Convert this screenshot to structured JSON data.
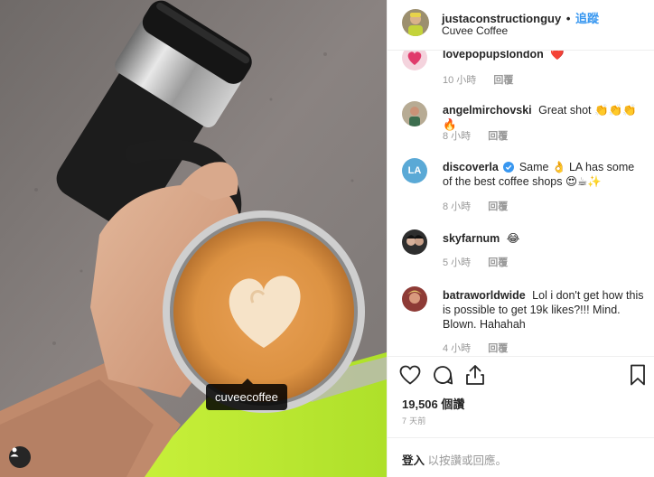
{
  "post": {
    "photo_tag": "cuveecoffee",
    "author": {
      "username": "justaconstructionguy",
      "dot": "•",
      "follow_label": "追蹤",
      "location": "Cuvee Coffee"
    },
    "comments": [
      {
        "username": "lovepopupslondon",
        "text": "❤️",
        "time": "10 小時",
        "reply": "回覆",
        "avatar_color": "#e03a6b"
      },
      {
        "username": "angelmirchovski",
        "text": "Great shot 👏👏👏🔥",
        "time": "8 小時",
        "reply": "回覆",
        "avatar_color": "#9a8f7a"
      },
      {
        "username": "discoverla",
        "verified": true,
        "text": "Same 👌 LA has some of the best coffee shops 😍☕✨",
        "time": "8 小時",
        "reply": "回覆",
        "avatar_label": "LA",
        "avatar_color": "#5aa9d6"
      },
      {
        "username": "skyfarnum",
        "text": "😂",
        "time": "5 小時",
        "reply": "回覆",
        "avatar_color": "#3a3a3a"
      },
      {
        "username": "batraworldwide",
        "text": "Lol i don't get how this is possible to get 19k likes?!!! Mind. Blown. Hahahah",
        "time": "4 小時",
        "reply": "回覆",
        "avatar_color": "#c0504d"
      }
    ],
    "likes": "19,506 個讚",
    "time_ago": "7 天前",
    "login_link": "登入",
    "login_rest": " 以按讚或回應。"
  },
  "icons": {
    "like": "heart-icon",
    "comment": "comment-icon",
    "share": "share-icon",
    "save": "bookmark-icon",
    "user_tags": "user-icon",
    "verified": "verified-badge-icon"
  },
  "colors": {
    "follow": "#3897f0",
    "verified": "#3897f0",
    "text_primary": "#262626",
    "text_secondary": "#999999",
    "divider": "#efefef"
  }
}
